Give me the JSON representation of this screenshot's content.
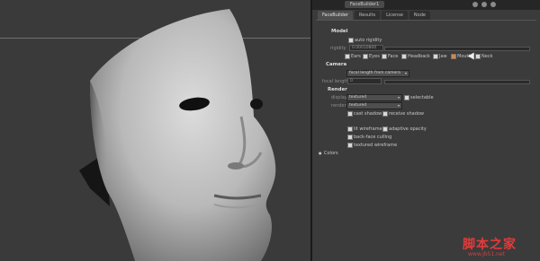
{
  "panel": {
    "window_title": "FaceBuilder1",
    "tabs": [
      "FaceBuilder",
      "Results",
      "License",
      "Node"
    ],
    "model": {
      "section": "Model",
      "auto_rigidity": "auto rigidity",
      "rigidity_label": "rigidity",
      "rigidity_value": "0.00010800",
      "parts": [
        "Ears",
        "Eyes",
        "Face",
        "Headback",
        "Jaw",
        "Mouth",
        "Neck"
      ]
    },
    "camera": {
      "section": "Camera",
      "focal_dropdown": "focal length from camera",
      "focal_label": "focal length",
      "focal_value": "0"
    },
    "render": {
      "section": "Render",
      "display_label": "display",
      "display_value": "textured",
      "selectable": "selectable",
      "render_label": "render",
      "render_value": "textured",
      "cast_shadow": "cast shadow",
      "receive_shadow": "receive shadow",
      "lit_wireframe": "lit wireframe",
      "adaptive_opacity": "adaptive opacity",
      "back_face_culling": "back-face culling",
      "textured_wireframe": "textured wireframe"
    },
    "colors": "Colors"
  },
  "watermark": {
    "main": "脚本之家",
    "sub": "www.jb51.net"
  },
  "colors": {
    "accent_checkbox": "#e0843a",
    "watermark": "#e23b3b"
  }
}
